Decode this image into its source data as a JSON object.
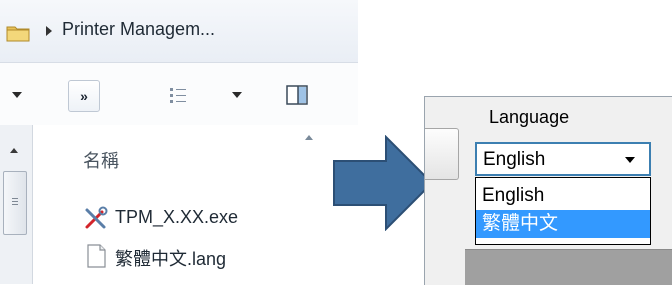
{
  "explorer": {
    "breadcrumb": "Printer Managem...",
    "toolbar": {
      "more_button": "»"
    },
    "column_header": "名稱",
    "files": [
      {
        "name": "TPM_X.XX.exe",
        "icon": "tools-exe-icon"
      },
      {
        "name": "繁體中文.lang",
        "icon": "document-icon"
      }
    ]
  },
  "arrow": {
    "color": "#3f6e9e",
    "icon": "right-arrow-icon"
  },
  "dialog": {
    "language_label": "Language",
    "language_select": {
      "selected": "English",
      "options": [
        "English",
        "繁體中文"
      ],
      "highlighted": "繁體中文"
    },
    "accent": "#3399ff"
  }
}
